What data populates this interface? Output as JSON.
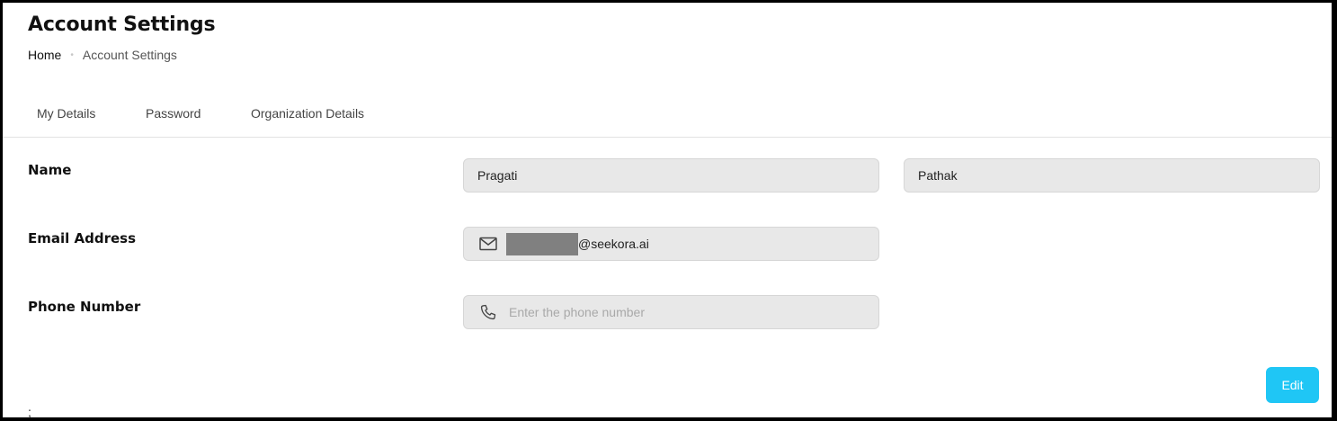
{
  "page": {
    "title": "Account Settings",
    "breadcrumb": {
      "home": "Home",
      "separator": "•",
      "current": "Account Settings"
    }
  },
  "tabs": [
    {
      "label": "My Details"
    },
    {
      "label": "Password"
    },
    {
      "label": "Organization Details"
    }
  ],
  "form": {
    "name": {
      "label": "Name",
      "first_value": "Pragati",
      "last_value": "Pathak"
    },
    "email": {
      "label": "Email Address",
      "icon": "mail-icon",
      "domain_text": "@seekora.ai",
      "local_part_redacted": true
    },
    "phone": {
      "label": "Phone Number",
      "icon": "phone-icon",
      "value": "",
      "placeholder": "Enter the phone number"
    }
  },
  "actions": {
    "edit_label": "Edit"
  },
  "stray_text": ";",
  "colors": {
    "accent": "#1fc6f5",
    "field_bg": "#e8e8e8",
    "redaction": "#808080"
  }
}
